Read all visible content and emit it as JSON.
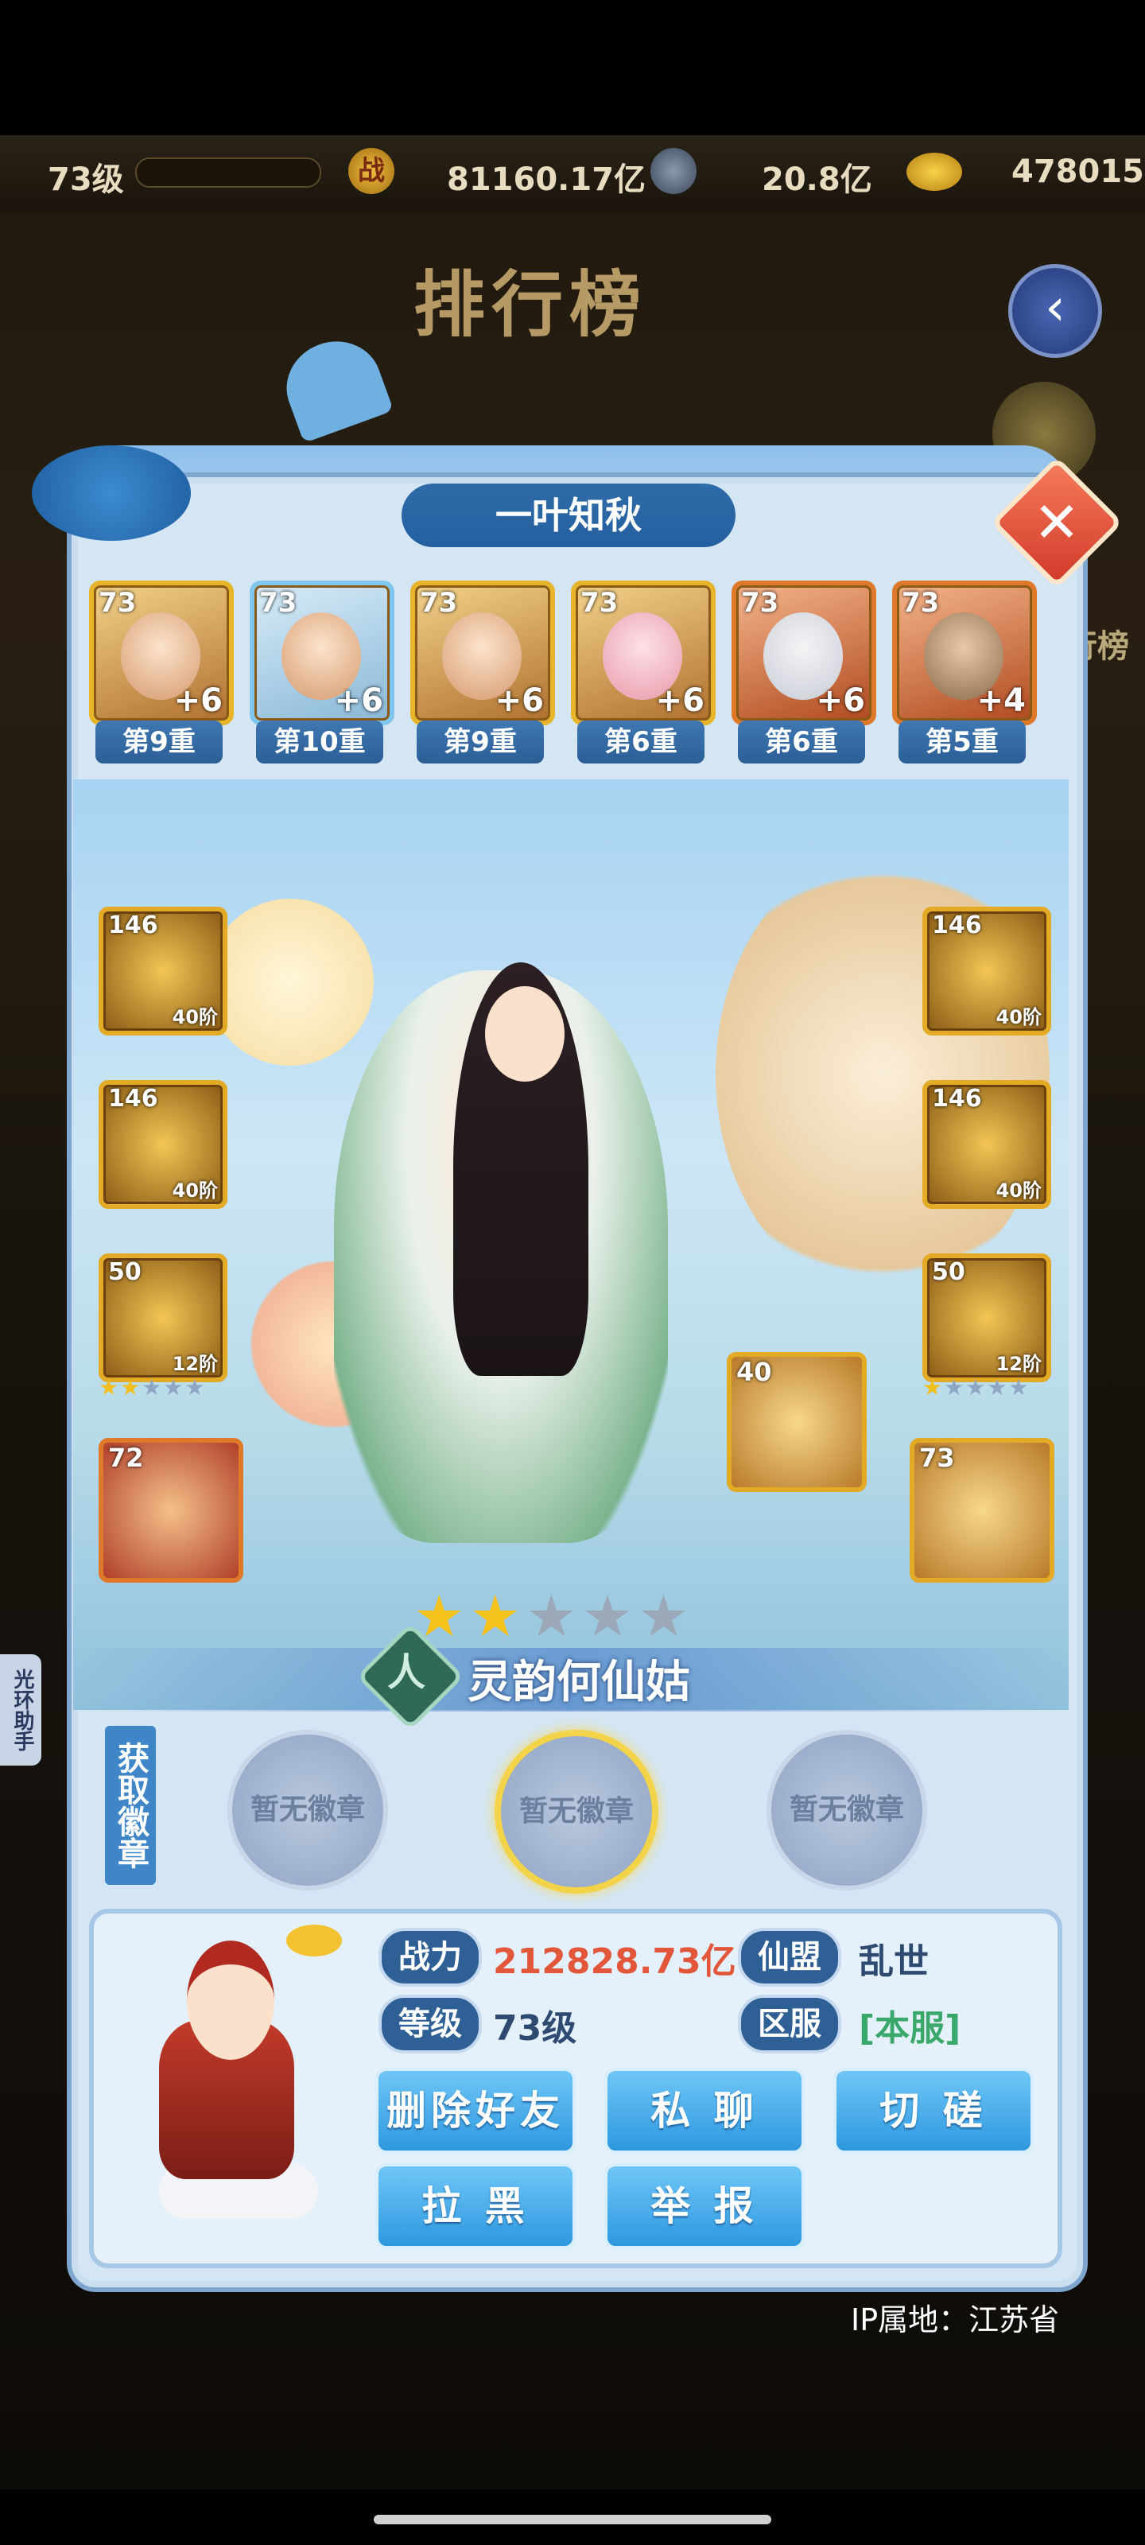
{
  "topbar": {
    "level": "73级",
    "power_icon": "战",
    "power": "81160.17亿",
    "coins": "20.8亿",
    "ingots": "478015"
  },
  "page_title": "排行榜",
  "side_helper": "光环助手",
  "side_labels": {
    "right_menu": "排行榜"
  },
  "player_name": "一叶知秋",
  "heroes": [
    {
      "level": "73",
      "plus": "+6",
      "tier": "第9重"
    },
    {
      "level": "73",
      "plus": "+6",
      "tier": "第10重"
    },
    {
      "level": "73",
      "plus": "+6",
      "tier": "第9重"
    },
    {
      "level": "73",
      "plus": "+6",
      "tier": "第6重"
    },
    {
      "level": "73",
      "plus": "+6",
      "tier": "第6重"
    },
    {
      "level": "73",
      "plus": "+4",
      "tier": "第5重"
    }
  ],
  "equipment_left": [
    {
      "level": "146",
      "stage": "40阶"
    },
    {
      "level": "146",
      "stage": "40阶"
    },
    {
      "level": "50",
      "stage": "12阶",
      "stars": 2
    }
  ],
  "equipment_right": [
    {
      "level": "146",
      "stage": "40阶"
    },
    {
      "level": "146",
      "stage": "40阶"
    },
    {
      "level": "50",
      "stage": "12阶",
      "stars": 1
    }
  ],
  "pets": [
    {
      "level": "72"
    },
    {
      "level": "40"
    },
    {
      "level": "73"
    }
  ],
  "character": {
    "faction": "人",
    "name": "灵韵何仙姑",
    "stars_filled": 2,
    "stars_total": 5
  },
  "badges": {
    "tab_label": "获取徽章",
    "slots": [
      "暂无徽章",
      "暂无徽章",
      "暂无徽章"
    ]
  },
  "info": {
    "power_label": "战力",
    "power_value": "212828.73亿",
    "guild_label": "仙盟",
    "guild_value": "乱世",
    "level_label": "等级",
    "level_value": "73级",
    "server_label": "区服",
    "server_value": "[本服]"
  },
  "actions": {
    "delete_friend": "删除好友",
    "private_chat": "私 聊",
    "spar": "切 磋",
    "block": "拉 黑",
    "report": "举 报"
  },
  "ip_location": "IP属地：江苏省",
  "colors": {
    "power_value": "#e2563a",
    "server_value": "#3aa86a",
    "accent_blue": "#2e98e0"
  }
}
